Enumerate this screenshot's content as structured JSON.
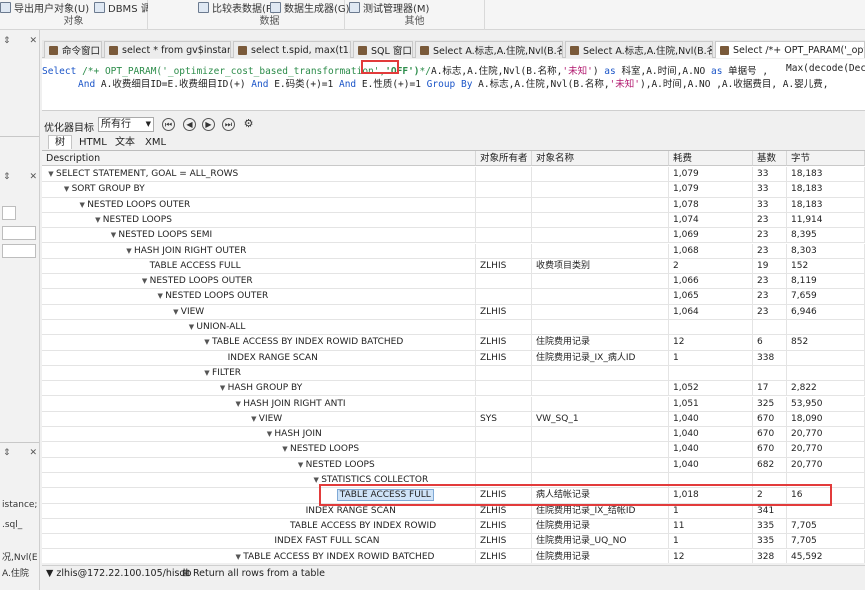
{
  "ribbon": {
    "groups": [
      {
        "caption": "对象",
        "items": [
          "导出用户对象(U)",
          "DBMS 调度程序(S)"
        ]
      },
      {
        "caption": "数据",
        "items": [
          "比较表数据(P)",
          "数据生成器(G)"
        ]
      },
      {
        "caption": "其他",
        "items": [
          "测试管理器(M)"
        ]
      }
    ]
  },
  "left_dock": {
    "pin": "⇕",
    "fragments": [
      "istance;",
      ".sql_",
      "况,Nvl(E",
      "A.住院"
    ]
  },
  "tabs": [
    {
      "label": "命令窗口",
      "active": false
    },
    {
      "label": "select * from gv$instance;",
      "active": false
    },
    {
      "label": "select t.spid, max(t1.sql_",
      "active": false
    },
    {
      "label": "SQL 窗口",
      "active": false
    },
    {
      "label": "Select A.标志,A.住院,Nvl(B.名称,",
      "active": false
    },
    {
      "label": "Select A.标志,A.住院,Nvl(B.名称,",
      "active": false
    },
    {
      "label": "Select /*+ OPT_PARAM('_opt",
      "active": true
    }
  ],
  "editor": {
    "line1": {
      "kw_select": "Select",
      "hint_start": "/*+ OPT_PARAM('_optimizer_cost_based_transformation',",
      "hint_value": "'OFF')",
      "hint_end": "*/",
      "rest1": "A.标志,A.住院,",
      "fn_nvl": "Nvl",
      "rest2": "(B.名称,",
      "str_unknown": "'未知'",
      "rest3": ")",
      "kw_as1": "as",
      "rest4": "科室,A.时间,A.NO",
      "kw_as2": "as",
      "rest5": "单据号 ,",
      "rest6": "Max(decode(Dec"
    },
    "line2": {
      "kw_and1": "And",
      "rest1": "A.收费细目ID=E.收费细目ID(+)",
      "kw_and2": "And",
      "rest2": "E.码类(+)=1",
      "kw_and3": "And",
      "rest3": "E.性质(+)=1",
      "kw_group": "Group By",
      "rest4": "A.标志,A.住院,",
      "fn_nvl": "Nvl",
      "rest5": "(B.名称,",
      "str_unknown": "'未知'",
      "rest6": "),A.时间,A.NO ,A.收据费目, A.婴儿费,"
    }
  },
  "optimizer": {
    "label": "优化器目标",
    "goal": "所有行",
    "view_tabs": [
      "树",
      "HTML",
      "文本",
      "XML"
    ],
    "active_view": "树"
  },
  "plan": {
    "headers": [
      "Description",
      "对象所有者",
      "对象名称",
      "耗费",
      "基数",
      "字节"
    ],
    "rows": [
      {
        "indent": 0,
        "twisty": "v",
        "desc": "SELECT STATEMENT, GOAL = ALL_ROWS",
        "owner": "",
        "name": "",
        "cost": "1,079",
        "card": "33",
        "bytes": "18,183"
      },
      {
        "indent": 1,
        "twisty": "v",
        "desc": "SORT GROUP BY",
        "owner": "",
        "name": "",
        "cost": "1,079",
        "card": "33",
        "bytes": "18,183"
      },
      {
        "indent": 2,
        "twisty": "v",
        "desc": "NESTED LOOPS OUTER",
        "owner": "",
        "name": "",
        "cost": "1,078",
        "card": "33",
        "bytes": "18,183"
      },
      {
        "indent": 3,
        "twisty": "v",
        "desc": "NESTED LOOPS",
        "owner": "",
        "name": "",
        "cost": "1,074",
        "card": "23",
        "bytes": "11,914"
      },
      {
        "indent": 4,
        "twisty": "v",
        "desc": "NESTED LOOPS SEMI",
        "owner": "",
        "name": "",
        "cost": "1,069",
        "card": "23",
        "bytes": "8,395"
      },
      {
        "indent": 5,
        "twisty": "v",
        "desc": "HASH JOIN RIGHT OUTER",
        "owner": "",
        "name": "",
        "cost": "1,068",
        "card": "23",
        "bytes": "8,303"
      },
      {
        "indent": 6,
        "twisty": "",
        "desc": "TABLE ACCESS FULL",
        "owner": "ZLHIS",
        "name": "收费项目类别",
        "cost": "2",
        "card": "19",
        "bytes": "152"
      },
      {
        "indent": 6,
        "twisty": "v",
        "desc": "NESTED LOOPS OUTER",
        "owner": "",
        "name": "",
        "cost": "1,066",
        "card": "23",
        "bytes": "8,119"
      },
      {
        "indent": 7,
        "twisty": "v",
        "desc": "NESTED LOOPS OUTER",
        "owner": "",
        "name": "",
        "cost": "1,065",
        "card": "23",
        "bytes": "7,659"
      },
      {
        "indent": 8,
        "twisty": "v",
        "desc": "VIEW",
        "owner": "ZLHIS",
        "name": "",
        "cost": "1,064",
        "card": "23",
        "bytes": "6,946"
      },
      {
        "indent": 9,
        "twisty": "v",
        "desc": "UNION-ALL",
        "owner": "",
        "name": "",
        "cost": "",
        "card": "",
        "bytes": ""
      },
      {
        "indent": 10,
        "twisty": "v",
        "desc": "TABLE ACCESS BY INDEX ROWID BATCHED",
        "owner": "ZLHIS",
        "name": "住院费用记录",
        "cost": "12",
        "card": "6",
        "bytes": "852"
      },
      {
        "indent": 11,
        "twisty": "",
        "desc": "INDEX RANGE SCAN",
        "owner": "ZLHIS",
        "name": "住院费用记录_IX_病人ID",
        "cost": "1",
        "card": "338",
        "bytes": ""
      },
      {
        "indent": 10,
        "twisty": "v",
        "desc": "FILTER",
        "owner": "",
        "name": "",
        "cost": "",
        "card": "",
        "bytes": ""
      },
      {
        "indent": 11,
        "twisty": "v",
        "desc": "HASH GROUP BY",
        "owner": "",
        "name": "",
        "cost": "1,052",
        "card": "17",
        "bytes": "2,822"
      },
      {
        "indent": 12,
        "twisty": "v",
        "desc": "HASH JOIN RIGHT ANTI",
        "owner": "",
        "name": "",
        "cost": "1,051",
        "card": "325",
        "bytes": "53,950"
      },
      {
        "indent": 13,
        "twisty": "v",
        "desc": "VIEW",
        "owner": "SYS",
        "name": "VW_SQ_1",
        "cost": "1,040",
        "card": "670",
        "bytes": "18,090"
      },
      {
        "indent": 14,
        "twisty": "v",
        "desc": "HASH JOIN",
        "owner": "",
        "name": "",
        "cost": "1,040",
        "card": "670",
        "bytes": "20,770"
      },
      {
        "indent": 15,
        "twisty": "v",
        "desc": "NESTED LOOPS",
        "owner": "",
        "name": "",
        "cost": "1,040",
        "card": "670",
        "bytes": "20,770"
      },
      {
        "indent": 16,
        "twisty": "v",
        "desc": "NESTED LOOPS",
        "owner": "",
        "name": "",
        "cost": "1,040",
        "card": "682",
        "bytes": "20,770"
      },
      {
        "indent": 17,
        "twisty": "v",
        "desc": "STATISTICS COLLECTOR",
        "owner": "",
        "name": "",
        "cost": "",
        "card": "",
        "bytes": ""
      },
      {
        "indent": 18,
        "twisty": "",
        "desc": "TABLE ACCESS FULL",
        "owner": "ZLHIS",
        "name": "病人结帐记录",
        "cost": "1,018",
        "card": "2",
        "bytes": "16",
        "selected": true
      },
      {
        "indent": 16,
        "twisty": "",
        "desc": "INDEX RANGE SCAN",
        "owner": "ZLHIS",
        "name": "住院费用记录_IX_结帐ID",
        "cost": "1",
        "card": "341",
        "bytes": ""
      },
      {
        "indent": 15,
        "twisty": "",
        "desc": "TABLE ACCESS BY INDEX ROWID",
        "owner": "ZLHIS",
        "name": "住院费用记录",
        "cost": "11",
        "card": "335",
        "bytes": "7,705"
      },
      {
        "indent": 14,
        "twisty": "",
        "desc": "INDEX FAST FULL SCAN",
        "owner": "ZLHIS",
        "name": "住院费用记录_UQ_NO",
        "cost": "1",
        "card": "335",
        "bytes": "7,705"
      },
      {
        "indent": 12,
        "twisty": "v",
        "desc": "TABLE ACCESS BY INDEX ROWID BATCHED",
        "owner": "ZLHIS",
        "name": "住院费用记录",
        "cost": "12",
        "card": "328",
        "bytes": "45,592"
      }
    ]
  },
  "status": {
    "connection": "zlhis@172.22.100.105/hisdb",
    "message": "Return all rows from a table"
  },
  "colors": {
    "highlight": "#e23b3b",
    "keyword": "#1b55c8",
    "comment": "#2c8c4a",
    "string": "#b0166d"
  }
}
